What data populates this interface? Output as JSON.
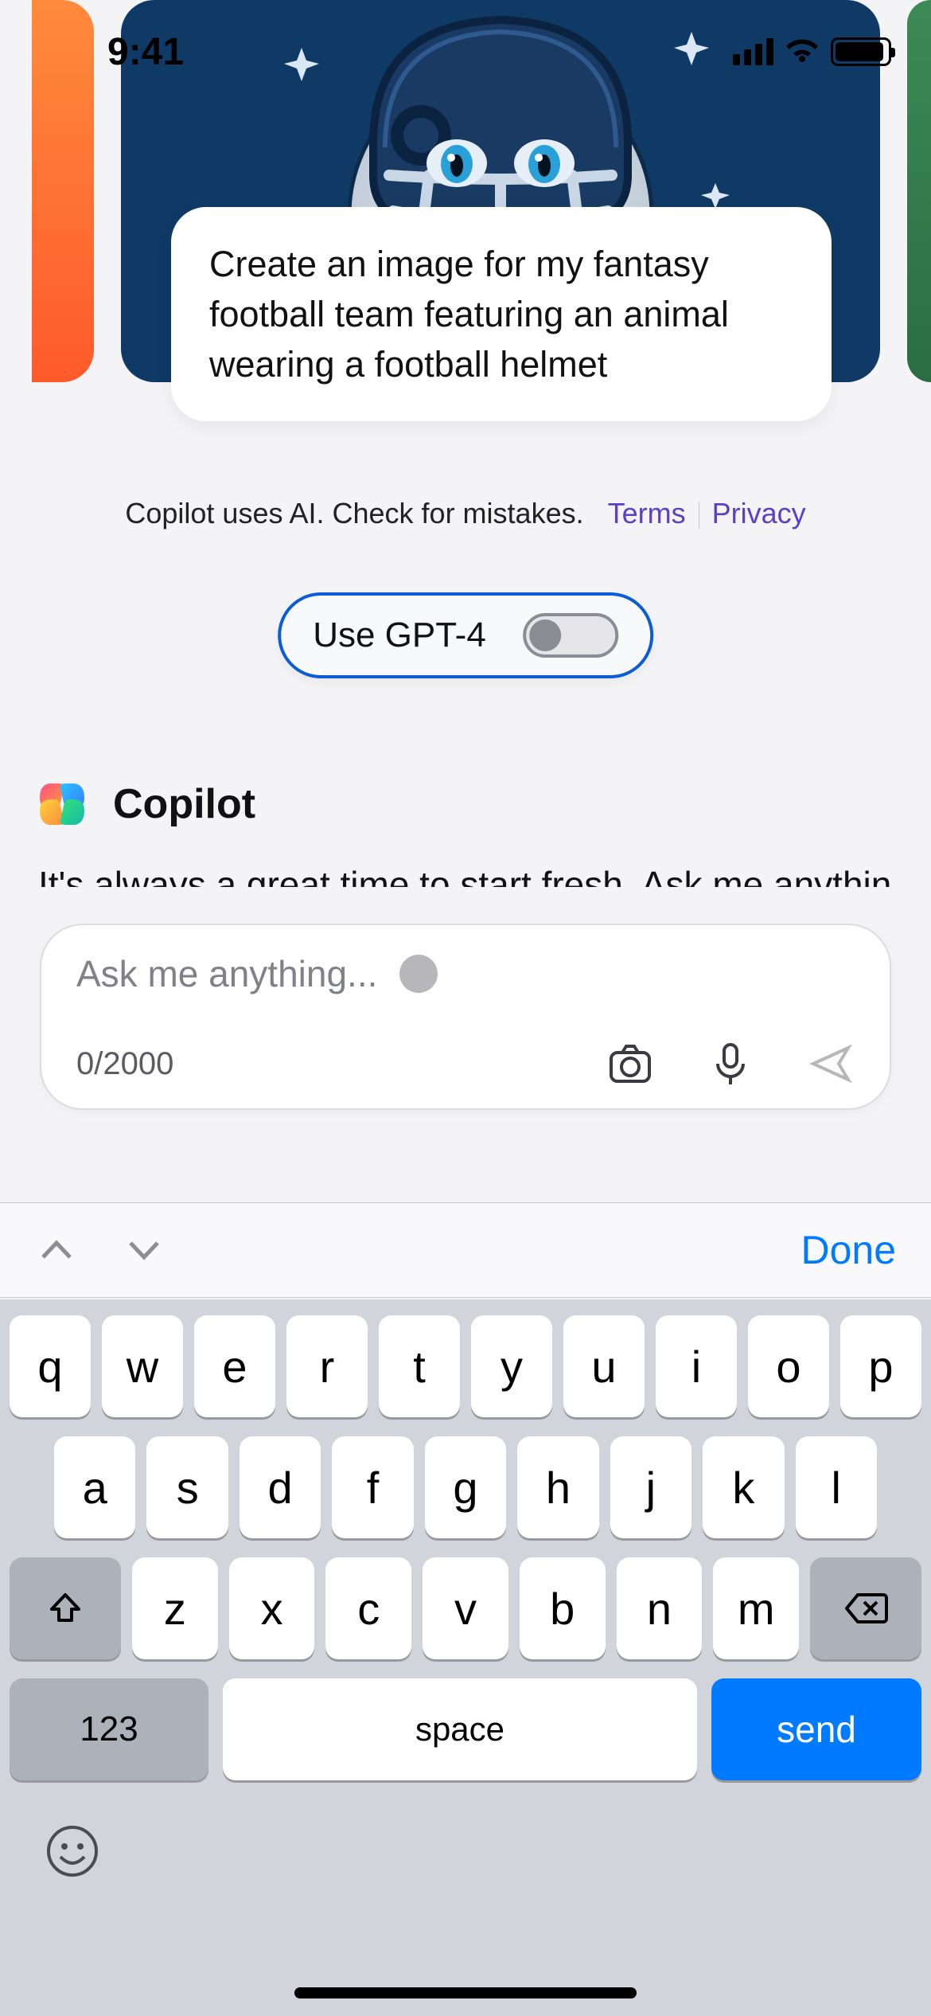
{
  "status": {
    "time": "9:41"
  },
  "preview": {
    "prompt_text": "Create an image for my fantasy football team featuring an animal wearing a football helmet"
  },
  "disclaimer": {
    "text": "Copilot uses AI. Check for mistakes.",
    "terms_label": "Terms",
    "privacy_label": "Privacy"
  },
  "gpt_toggle": {
    "label": "Use GPT-4",
    "enabled": false
  },
  "agent": {
    "name": "Copilot"
  },
  "clipped_message": "It's always a great time to start fresh. Ask me anything!",
  "input": {
    "placeholder": "Ask me anything...",
    "counter": "0/2000",
    "max_chars": 2000
  },
  "keyboard": {
    "done_label": "Done",
    "rows": {
      "r1": [
        "q",
        "w",
        "e",
        "r",
        "t",
        "y",
        "u",
        "i",
        "o",
        "p"
      ],
      "r2": [
        "a",
        "s",
        "d",
        "f",
        "g",
        "h",
        "j",
        "k",
        "l"
      ],
      "r3": [
        "z",
        "x",
        "c",
        "v",
        "b",
        "n",
        "m"
      ]
    },
    "numbers_label": "123",
    "space_label": "space",
    "send_label": "send"
  }
}
